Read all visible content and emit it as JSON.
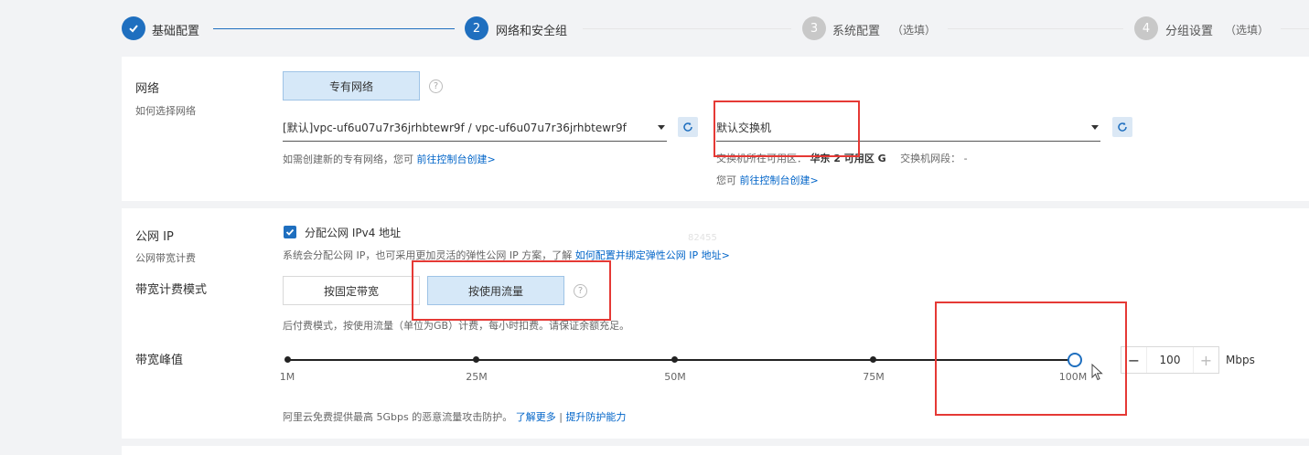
{
  "steps": [
    {
      "num": "1",
      "label": "基础配置",
      "optional": ""
    },
    {
      "num": "2",
      "label": "网络和安全组",
      "optional": ""
    },
    {
      "num": "3",
      "label": "系统配置",
      "optional": "（选填）"
    },
    {
      "num": "4",
      "label": "分组设置",
      "optional": "（选填）"
    }
  ],
  "network": {
    "label": "网络",
    "sublabel": "如何选择网络",
    "type_button": "专有网络",
    "vpc_select_value": "[默认]vpc-uf6u07u7r36jrhbtewr9f / vpc-uf6u07u7r36jrhbtewr9f",
    "vpc_hint_text": "如需创建新的专有网络，您可",
    "vpc_hint_link": "前往控制台创建>",
    "switch_select_value": "默认交换机",
    "switch_zone_label": "交换机所在可用区：",
    "switch_zone_value": "华东 2 可用区 G",
    "switch_cidr_label": "交换机网段：",
    "switch_cidr_value": "-",
    "switch_hint_text": "您可",
    "switch_hint_link": "前往控制台创建>"
  },
  "public_ip": {
    "label": "公网 IP",
    "sublabel": "公网带宽计费",
    "checkbox_label": "分配公网 IPv4 地址",
    "checked": true,
    "watermark": "82455",
    "hint_text": "系统会分配公网 IP，也可采用更加灵活的弹性公网 IP 方案，了解",
    "hint_link": "如何配置并绑定弹性公网 IP 地址>",
    "billing_label": "带宽计费模式",
    "billing_options": [
      "按固定带宽",
      "按使用流量"
    ],
    "billing_selected": "按使用流量",
    "billing_hint": "后付费模式，按使用流量（单位为GB）计费，每小时扣费。请保证余额充足。",
    "peak_label": "带宽峰值",
    "ticks": [
      "1M",
      "25M",
      "50M",
      "75M",
      "100M"
    ],
    "slider_value": 100,
    "stepper_value": "100",
    "stepper_minus": "−",
    "stepper_plus": "+",
    "unit": "Mbps",
    "ddos_text": "阿里云免费提供最高 5Gbps 的恶意流量攻击防护。",
    "ddos_link1": "了解更多",
    "ddos_sep": "|",
    "ddos_link2": "提升防护能力"
  },
  "colors": {
    "accent": "#1f6fbf",
    "highlight_box": "#e53935",
    "link": "#0064c8"
  }
}
